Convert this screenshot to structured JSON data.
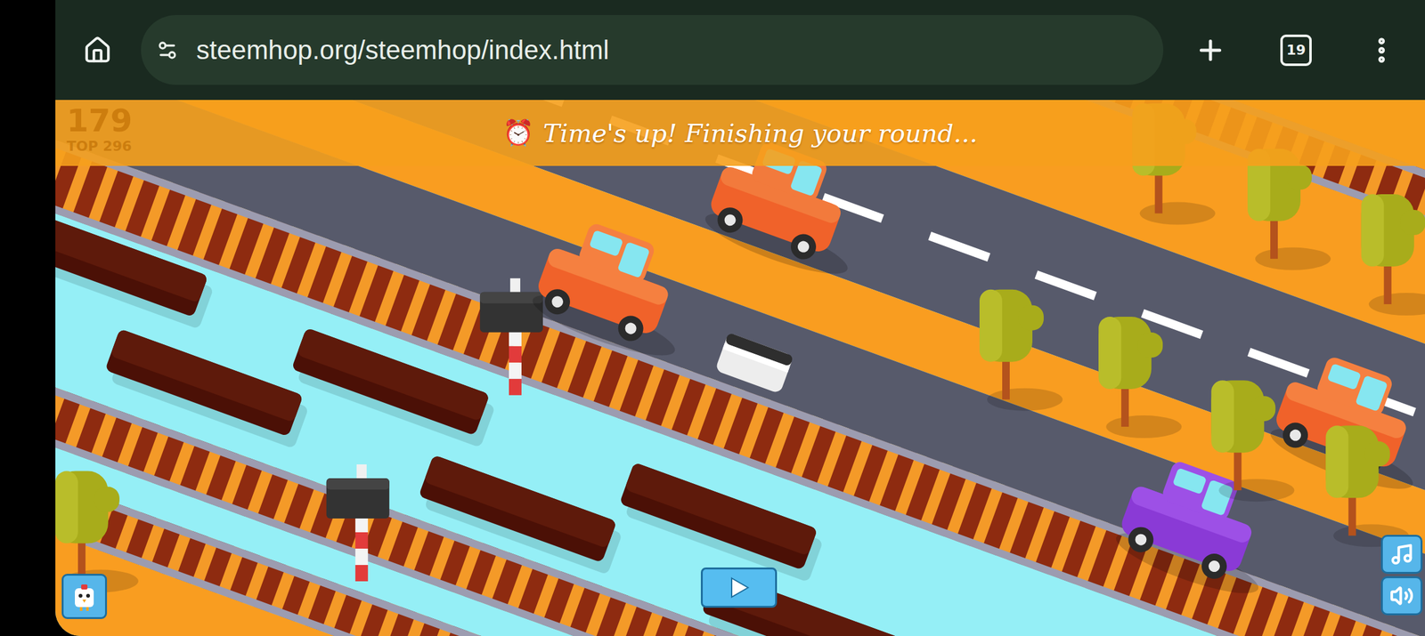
{
  "browser": {
    "url": "steemhop.org/steemhop/index.html",
    "tab_count": "19"
  },
  "game": {
    "score": "179",
    "top": "TOP 296",
    "banner": {
      "icon": "⏰",
      "message": "Time's up! Finishing your round..."
    }
  }
}
